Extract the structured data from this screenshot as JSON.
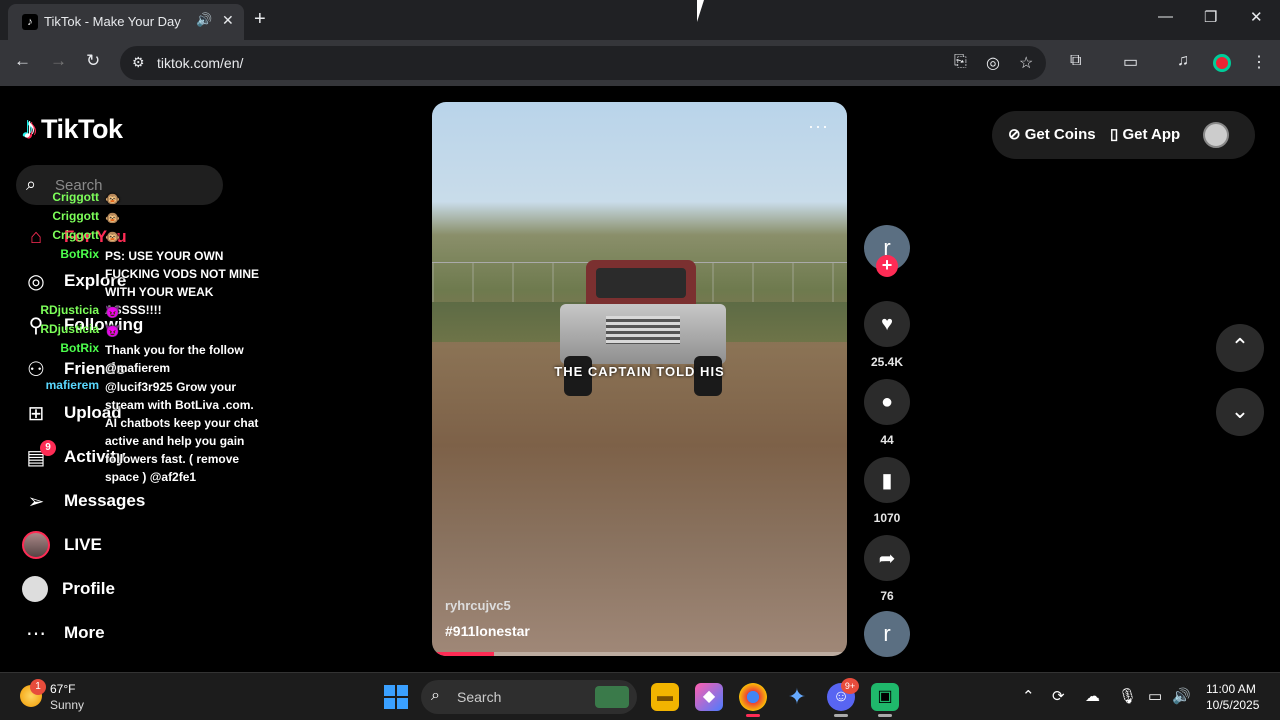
{
  "browser": {
    "tab_title": "TikTok - Make Your Day",
    "tab_favicon": "tiktok-favicon",
    "url": "tiktok.com/en/",
    "icons": [
      "back-icon",
      "forward-icon",
      "reload-icon",
      "site-info-icon",
      "install-app-icon",
      "eye-off-icon",
      "star-icon",
      "extensions-icon",
      "tab-search-icon",
      "media-icon",
      "profile-icon",
      "menu-icon"
    ]
  },
  "tiktok": {
    "logo_text": "TikTok",
    "search_placeholder": "Search",
    "nav": {
      "home": "For You",
      "explore": "Explore",
      "following": "Following",
      "friends": "Friends",
      "upload": "Upload",
      "activity": "Activity",
      "activity_badge": "9",
      "messages": "Messages",
      "live": "LIVE",
      "profile": "Profile",
      "more": "More"
    },
    "header": {
      "get_coins": "Get Coins",
      "get_app": "Get App"
    },
    "video": {
      "caption": "THE CAPTAIN TOLD HIS",
      "username": "ryhrcujvc5",
      "hashtag": "#911lonestar",
      "progress": 0.15,
      "menu": "···"
    },
    "creator_initial": "r",
    "actions": {
      "likes": "25.4K",
      "comments": "44",
      "saves": "1070",
      "shares": "76"
    }
  },
  "chat": [
    {
      "name": "Criggott",
      "color": "#7dff5a",
      "msg": "🐵"
    },
    {
      "name": "Criggott",
      "color": "#7dff5a",
      "msg": "🐵"
    },
    {
      "name": "Criggott",
      "color": "#7dff5a",
      "msg": "🐵"
    },
    {
      "name": "BotRix",
      "color": "#4dff4d",
      "msg": "PS: USE YOUR OWN FUCKING VODS NOT MINE WITH YOUR WEAK ASSSS!!!!"
    },
    {
      "name": "RDjusticia",
      "color": "#7dff5a",
      "msg": "😈"
    },
    {
      "name": "RDjusticia",
      "color": "#7dff5a",
      "msg": "😈"
    },
    {
      "name": "BotRix",
      "color": "#4dff4d",
      "msg": "Thank you for the follow @mafierem"
    },
    {
      "name": "mafierem",
      "color": "#5ad8ff",
      "msg": "@lucif3r925 Grow your stream with BotLiva .com. AI chatbots keep your chat active and help you gain followers fast. ( remove space ) @af2fe1"
    }
  ],
  "taskbar": {
    "weather_temp": "67°F",
    "weather_desc": "Sunny",
    "weather_badge": "1",
    "search_label": "Search",
    "discord_badge": "9+",
    "time": "11:00 AM",
    "date": "10/5/2025"
  },
  "colors": {
    "accent": "#fe2c55",
    "chrome_bg": "#202124",
    "toolbar_bg": "#35363a"
  }
}
